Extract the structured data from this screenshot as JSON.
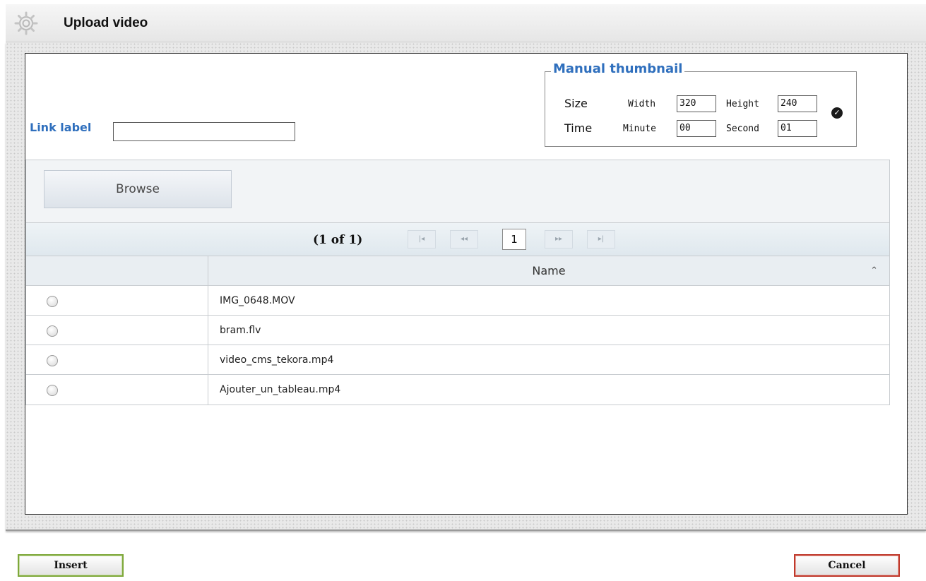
{
  "dialog": {
    "title": "Upload video",
    "icon": "gear-icon"
  },
  "form": {
    "link_label": "Link label",
    "link_value": ""
  },
  "thumbnail": {
    "legend": "Manual thumbnail",
    "size_label": "Size",
    "time_label": "Time",
    "width_label": "Width",
    "width_value": "320",
    "height_label": "Height",
    "height_value": "240",
    "minute_label": "Minute",
    "minute_value": "00",
    "second_label": "Second",
    "second_value": "01",
    "confirm_icon": "check-circle-icon"
  },
  "upload": {
    "browse_label": "Browse"
  },
  "paginator": {
    "count": "(1 of 1)",
    "current_page": "1",
    "first": "|◂",
    "prev": "◂◂",
    "next": "▸▸",
    "last": "▸|"
  },
  "table": {
    "header_name": "Name",
    "sort_icon": "sort-icon",
    "rows": [
      {
        "name": "IMG_0648.MOV"
      },
      {
        "name": "bram.flv"
      },
      {
        "name": "video_cms_tekora.mp4"
      },
      {
        "name": "Ajouter_un_tableau.mp4"
      }
    ]
  },
  "footer": {
    "insert_label": "Insert",
    "cancel_label": "Cancel"
  },
  "colors": {
    "accent_blue": "#2f6fbd",
    "insert_border": "#7ea83a",
    "cancel_border": "#c0392b"
  }
}
